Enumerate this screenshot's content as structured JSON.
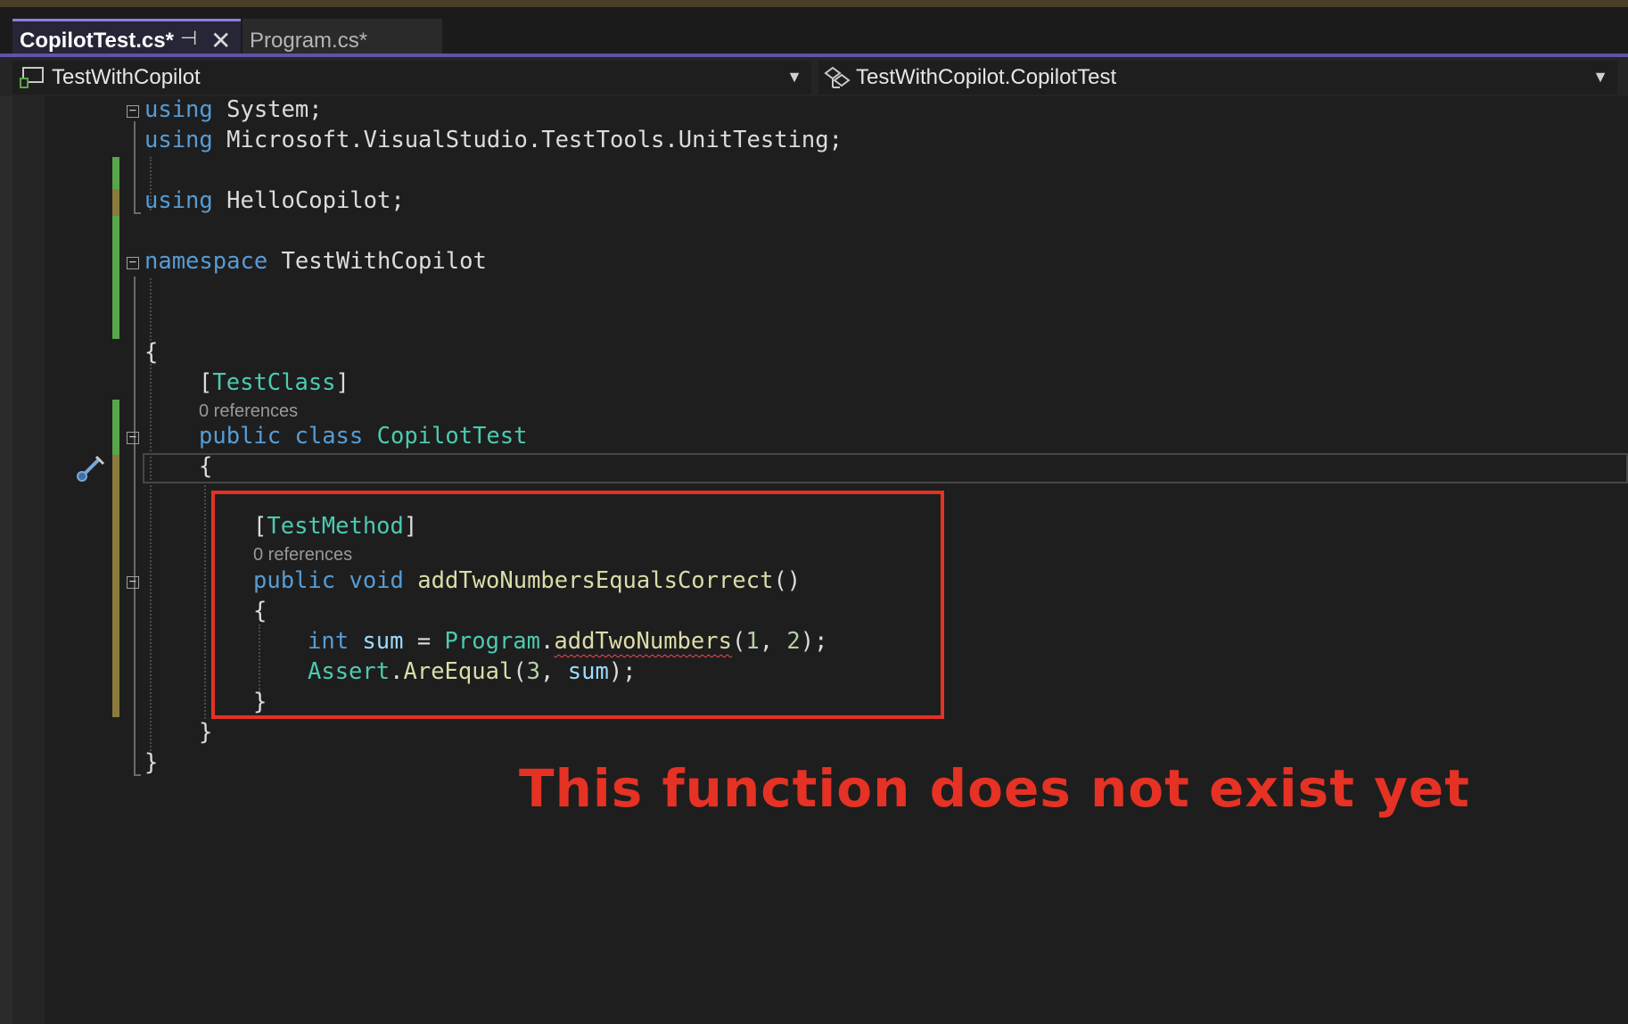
{
  "tabs": [
    {
      "label": "CopilotTest.cs*",
      "active": true
    },
    {
      "label": "Program.cs*",
      "active": false
    }
  ],
  "tab_pin_icon": "pin-icon",
  "tab_close_icon": "close-icon",
  "navbar": {
    "project": "TestWithCopilot",
    "member": "TestWithCopilot.CopilotTest"
  },
  "code": {
    "using_kw": "using",
    "line1_ns": "System;",
    "line2_ns": "Microsoft.VisualStudio.TestTools.UnitTesting;",
    "line4_ns": "HelloCopilot;",
    "namespace_kw": "namespace",
    "namespace_name": "TestWithCopilot",
    "open_brace": "{",
    "close_brace": "}",
    "attr_open": "[",
    "attr_close": "]",
    "test_class_attr": "TestClass",
    "public_kw": "public",
    "class_kw": "class",
    "class_name": "CopilotTest",
    "test_method_attr": "TestMethod",
    "void_kw": "void",
    "method_name": "addTwoNumbersEqualsCorrect",
    "parens": "()",
    "int_kw": "int",
    "sum_var": "sum",
    "assign": " = ",
    "program_type": "Program",
    "dot": ".",
    "add_fn": "addTwoNumbers",
    "call_open": "(",
    "num1": "1",
    "comma": ", ",
    "num2": "2",
    "call_close_semi": ");",
    "assert_type": "Assert",
    "are_equal_fn": "AreEqual",
    "num3": "3"
  },
  "codelens": {
    "class_refs": "0 references",
    "method_refs": "0 references"
  },
  "annotation": "This function does not exist yet",
  "colors": {
    "keyword": "#569cd6",
    "type": "#4ec9b0",
    "function": "#dcdcaa",
    "variable": "#9cdcfe",
    "number": "#b5cea8",
    "annotation": "#e53224",
    "change_saved": "#57a64a",
    "change_unsaved": "#8a7b3a"
  }
}
